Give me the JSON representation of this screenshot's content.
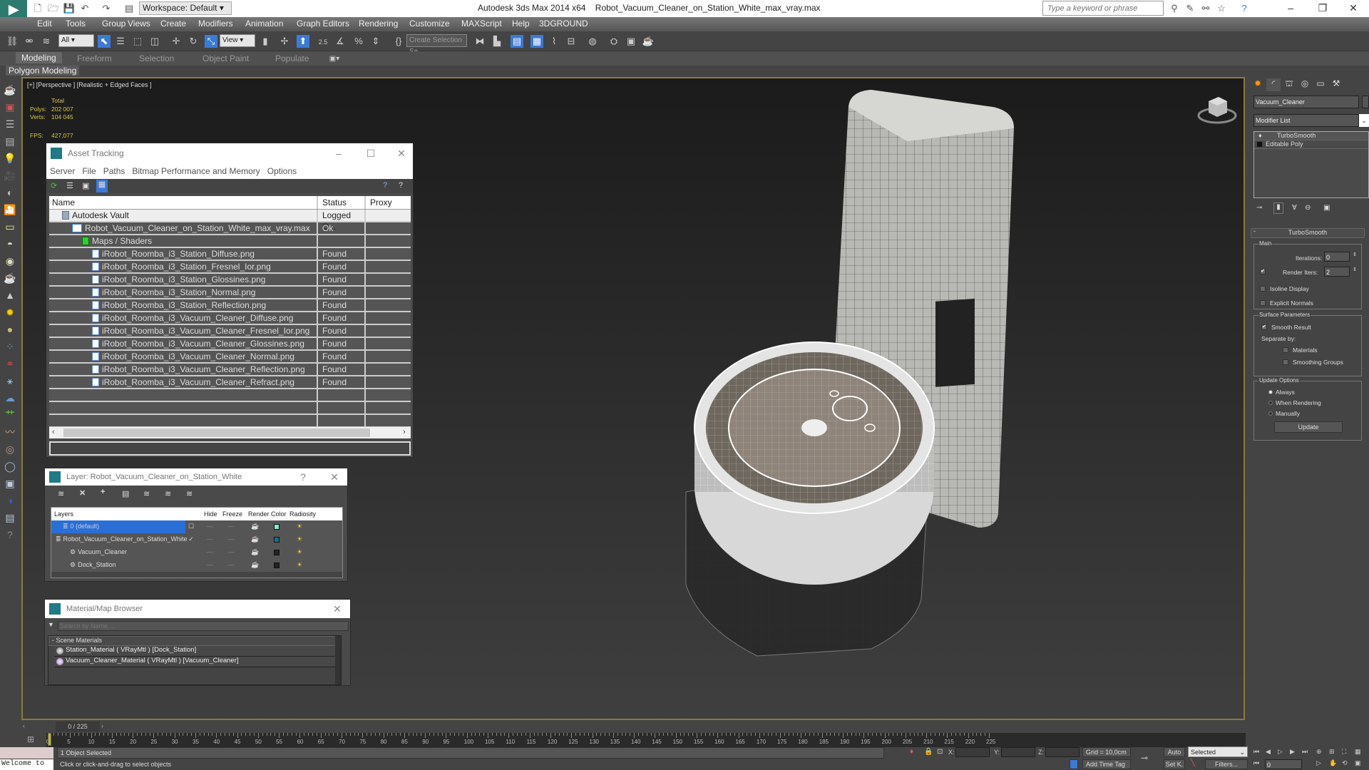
{
  "titlebar": {
    "app_name": "Autodesk 3ds Max  2014 x64",
    "file_name": "Robot_Vacuum_Cleaner_on_Station_White_max_vray.max",
    "workspace": "Workspace: Default",
    "search_placeholder": "Type a keyword or phrase"
  },
  "menu": [
    "Edit",
    "Tools",
    "Group",
    "Views",
    "Create",
    "Modifiers",
    "Animation",
    "Graph Editors",
    "Rendering",
    "Customize",
    "MAXScript",
    "Help",
    "3DGROUND"
  ],
  "toolbar": {
    "filter_value": "All",
    "ref_coord_value": "View",
    "snap_label": "2.5",
    "selection_set_placeholder": "Create Selection Se"
  },
  "ribbon": {
    "tabs": [
      "Modeling",
      "Freeform",
      "Selection",
      "Object Paint",
      "Populate"
    ],
    "active_tab": "Modeling",
    "panel": "Polygon Modeling"
  },
  "viewport": {
    "label": "[+] [Perspective ] [Realistic + Edged Faces ]",
    "stats": {
      "total_label": "Total",
      "polys_label": "Polys:",
      "polys": "202 007",
      "verts_label": "Verts:",
      "verts": "104 045",
      "fps_label": "FPS:",
      "fps": "427,077"
    }
  },
  "asset_tracking": {
    "title": "Asset Tracking",
    "menu": [
      "Server",
      "File",
      "Paths",
      "Bitmap Performance and Memory",
      "Options"
    ],
    "columns": [
      "Name",
      "Status",
      "Proxy Res..."
    ],
    "rows": [
      {
        "name": "Autodesk Vault",
        "status": "Logged O...",
        "indent": 1,
        "icon": "vault-icon"
      },
      {
        "name": "Robot_Vacuum_Cleaner_on_Station_White_max_vray.max",
        "status": "Ok",
        "indent": 2,
        "icon": "max-file-icon"
      },
      {
        "name": "Maps / Shaders",
        "status": "",
        "indent": 3,
        "icon": "maps-icon"
      },
      {
        "name": "iRobot_Roomba_i3_Station_Diffuse.png",
        "status": "Found",
        "indent": 4,
        "icon": "image-file-icon"
      },
      {
        "name": "iRobot_Roomba_i3_Station_Fresnel_Ior.png",
        "status": "Found",
        "indent": 4,
        "icon": "image-file-icon"
      },
      {
        "name": "iRobot_Roomba_i3_Station_Glossines.png",
        "status": "Found",
        "indent": 4,
        "icon": "image-file-icon"
      },
      {
        "name": "iRobot_Roomba_i3_Station_Normal.png",
        "status": "Found",
        "indent": 4,
        "icon": "image-file-icon"
      },
      {
        "name": "iRobot_Roomba_i3_Station_Reflection.png",
        "status": "Found",
        "indent": 4,
        "icon": "image-file-icon"
      },
      {
        "name": "iRobot_Roomba_i3_Vacuum_Cleaner_Diffuse.png",
        "status": "Found",
        "indent": 4,
        "icon": "image-file-icon"
      },
      {
        "name": "iRobot_Roomba_i3_Vacuum_Cleaner_Fresnel_Ior.png",
        "status": "Found",
        "indent": 4,
        "icon": "image-file-icon"
      },
      {
        "name": "iRobot_Roomba_i3_Vacuum_Cleaner_Glossines.png",
        "status": "Found",
        "indent": 4,
        "icon": "image-file-icon"
      },
      {
        "name": "iRobot_Roomba_i3_Vacuum_Cleaner_Normal.png",
        "status": "Found",
        "indent": 4,
        "icon": "image-file-icon"
      },
      {
        "name": "iRobot_Roomba_i3_Vacuum_Cleaner_Reflection.png",
        "status": "Found",
        "indent": 4,
        "icon": "image-file-icon"
      },
      {
        "name": "iRobot_Roomba_i3_Vacuum_Cleaner_Refract.png",
        "status": "Found",
        "indent": 4,
        "icon": "image-file-icon"
      }
    ]
  },
  "layers": {
    "title": "Layer: Robot_Vacuum_Cleaner_on_Station_White",
    "help": "?",
    "columns": [
      "Layers",
      "Hide",
      "Freeze",
      "Render",
      "Color",
      "Radiosity"
    ],
    "rows": [
      {
        "name": "0 (default)",
        "selected": true,
        "current": "box",
        "color": "#8fe3d3",
        "indent": 1
      },
      {
        "name": "Robot_Vacuum_Cleaner_on_Station_White",
        "selected": false,
        "current": "check",
        "color": "#1a6f8a",
        "indent": 0
      },
      {
        "name": "Vacuum_Cleaner",
        "selected": false,
        "current": "",
        "color": "#222222",
        "indent": 2
      },
      {
        "name": "Dock_Station",
        "selected": false,
        "current": "",
        "color": "#222222",
        "indent": 2
      }
    ]
  },
  "material_browser": {
    "title": "Material/Map Browser",
    "search_placeholder": "Search by Name ...",
    "section": "- Scene Materials",
    "items": [
      "Station_Material  ( VRayMtl ) [Dock_Station]",
      "Vacuum_Cleaner_Material  ( VRayMtl ) [Vacuum_Cleaner]"
    ]
  },
  "command_panel": {
    "object_name": "Vacuum_Cleaner",
    "modifier_list": "Modifier List",
    "stack": [
      "TurboSmooth",
      "Editable Poly"
    ],
    "turbosmooth": {
      "title": "TurboSmooth",
      "main_label": "Main",
      "iterations_label": "Iterations:",
      "iterations": "0",
      "render_iters_label": "Render Iters:",
      "render_iters": "2",
      "render_iters_checked": true,
      "isoline_label": "Isoline Display",
      "explicit_normals_label": "Explicit Normals",
      "surface_label": "Surface Parameters",
      "smooth_result_label": "Smooth Result",
      "separate_by_label": "Separate by:",
      "materials_label": "Materials",
      "smoothing_groups_label": "Smoothing Groups",
      "update_label": "Update Options",
      "always_label": "Always",
      "when_rendering_label": "When Rendering",
      "manually_label": "Manually",
      "update_button": "Update"
    }
  },
  "timeline": {
    "frame_display": "0 / 225",
    "current_frame": 0,
    "total_frames": 225,
    "ticks": [
      0,
      5,
      10,
      15,
      20,
      25,
      30,
      35,
      40,
      45,
      50,
      55,
      60,
      65,
      70,
      75,
      80,
      85,
      90,
      95,
      100,
      105,
      110,
      115,
      120,
      125,
      130,
      135,
      140,
      145,
      150,
      155,
      160,
      165,
      170,
      175,
      180,
      185,
      190,
      195,
      200,
      205,
      210,
      215,
      220,
      225
    ]
  },
  "status": {
    "selection": "1 Object Selected",
    "prompt": "Click or click-and-drag to select objects",
    "maxscript": "Welcome to",
    "x_label": "X:",
    "y_label": "Y:",
    "z_label": "Z:",
    "grid": "Grid = 10,0cm",
    "add_time_tag": "Add Time Tag",
    "auto": "Auto",
    "set_key": "Set K.",
    "key_filter": "Selected",
    "filters": "Filters...",
    "frame_field": "0"
  }
}
